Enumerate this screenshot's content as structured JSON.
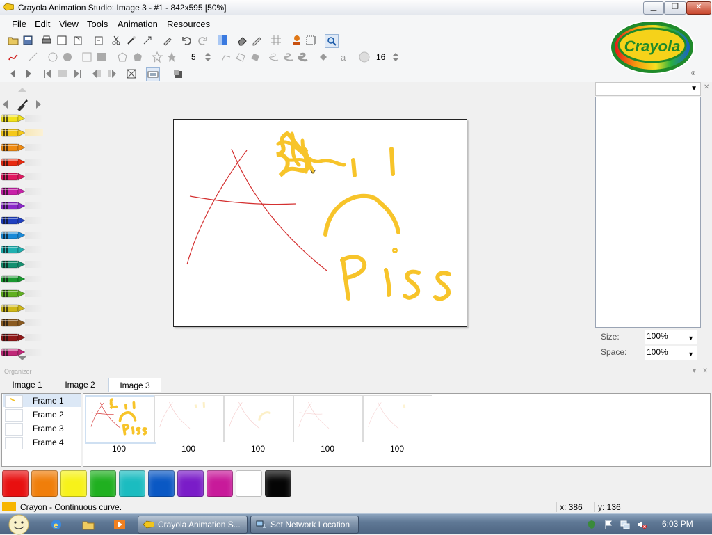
{
  "window": {
    "title": "Crayola Animation Studio: Image 3 - #1 - 842x595 [50%]",
    "minimize_label": "▁",
    "restore_label": "❐",
    "close_label": "✕"
  },
  "menu": {
    "items": [
      "File",
      "Edit",
      "View",
      "Tools",
      "Animation",
      "Resources"
    ]
  },
  "toolbar": {
    "shape_sides": "5",
    "brush_size": "16"
  },
  "logo": {
    "text": "Crayola",
    "mark": "®"
  },
  "right_panel": {
    "size_label": "Size:",
    "size_value": "100%",
    "space_label": "Space:",
    "space_value": "100%"
  },
  "organizer": {
    "header": "Organizer",
    "image_tabs": [
      "Image 1",
      "Image 2",
      "Image 3"
    ],
    "active_tab": "Image 3",
    "frames": [
      "Frame 1",
      "Frame 2",
      "Frame 3",
      "Frame 4"
    ],
    "film_labels": [
      "100",
      "100",
      "100",
      "100",
      "100"
    ]
  },
  "canvas": {
    "handwriting": "Pi ss"
  },
  "palette": {
    "colors": [
      "#e81010",
      "#f07e0a",
      "#f7f21a",
      "#20b020",
      "#1bbcc0",
      "#0a58c4",
      "#7a1cc8",
      "#c81a9a",
      "#ffffff",
      "#050505"
    ]
  },
  "crayons": {
    "colors": [
      "#f2e21c",
      "#f5c81a",
      "#f08a10",
      "#e82a10",
      "#e01860",
      "#c820a8",
      "#8a28c8",
      "#2040c0",
      "#1a8ad8",
      "#20b0b0",
      "#149070",
      "#1a9830",
      "#60b020",
      "#d0b818",
      "#8a5a20",
      "#901818",
      "#c02878"
    ]
  },
  "statusbar": {
    "text": "Crayon - Continuous curve.",
    "x": "x: 386",
    "y": "y: 136"
  },
  "taskbar": {
    "app1": "Crayola Animation S...",
    "app2": "Set Network Location",
    "clock": "6:03 PM"
  }
}
